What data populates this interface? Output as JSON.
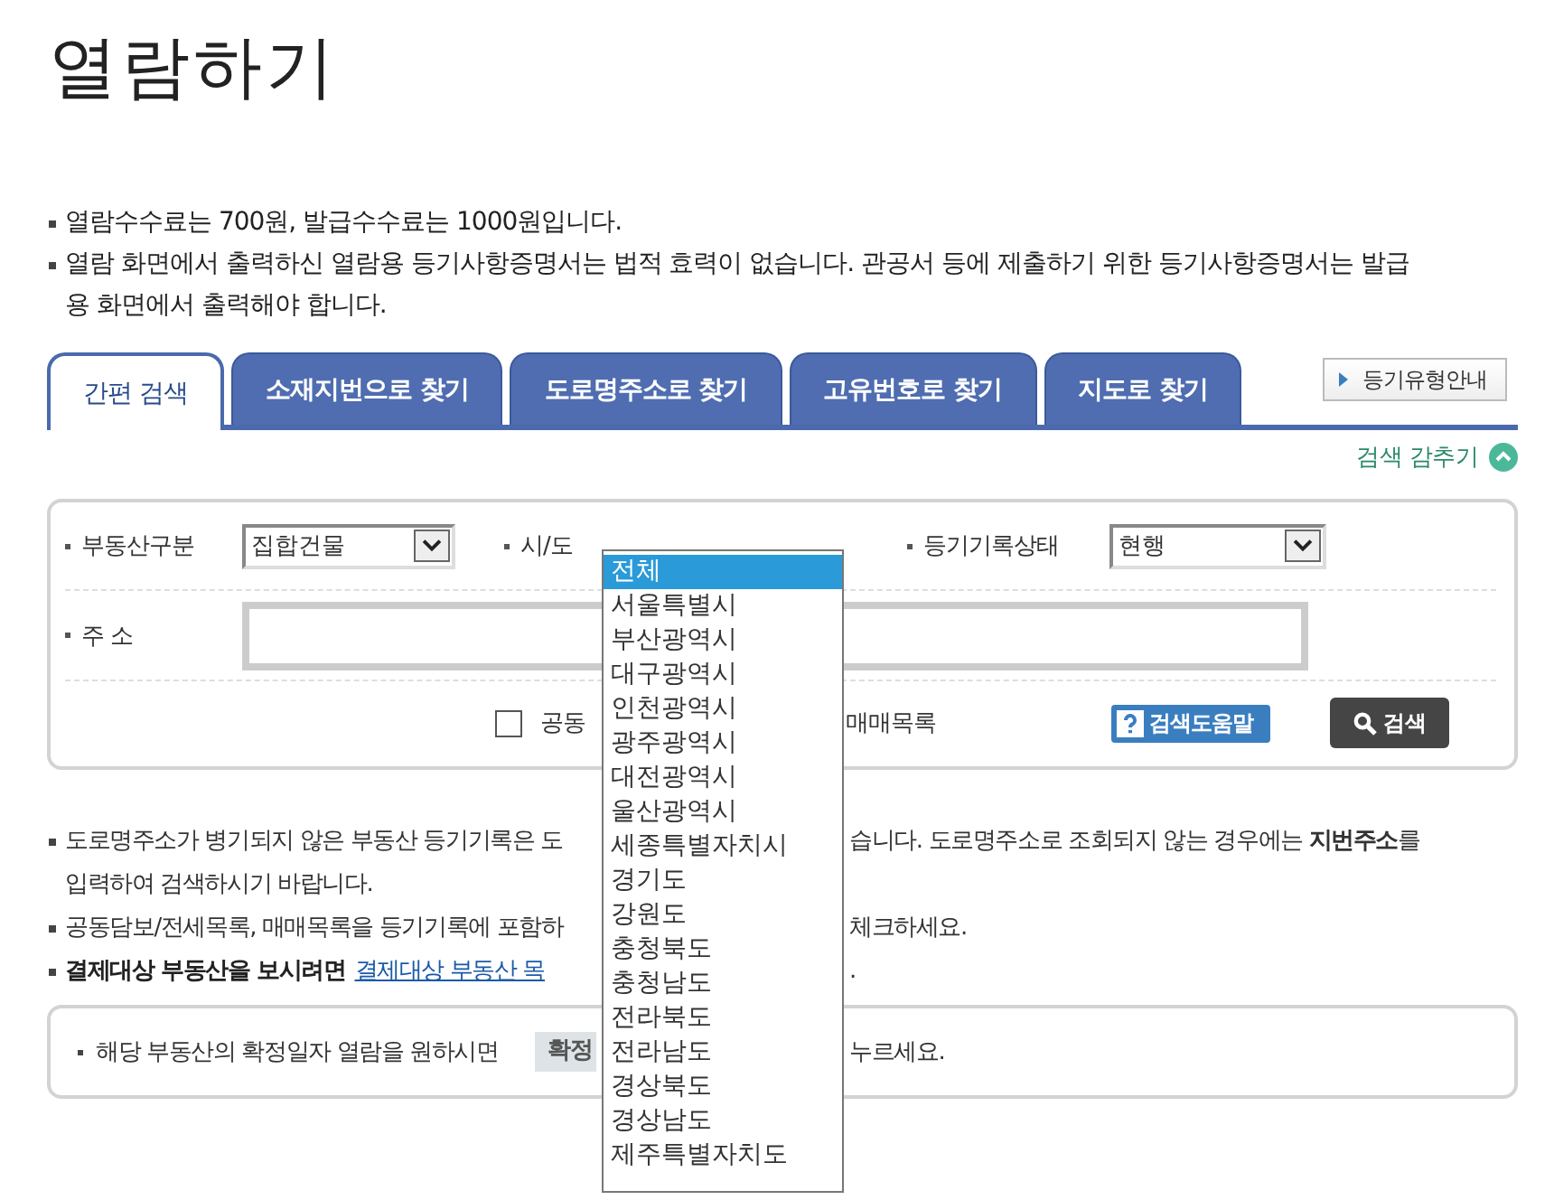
{
  "title": "열람하기",
  "notices": [
    "열람수수료는 700원, 발급수수료는 1000원입니다.",
    "열람 화면에서 출력하신 열람용 등기사항증명서는 법적 효력이 없습니다. 관공서 등에 제출하기 위한 등기사항증명서는 발급용 화면에서 출력해야 합니다."
  ],
  "tabs": [
    {
      "label": "간편 검색",
      "selected": true
    },
    {
      "label": "소재지번으로 찾기",
      "selected": false
    },
    {
      "label": "도로명주소로 찾기",
      "selected": false
    },
    {
      "label": "고유번호로 찾기",
      "selected": false
    },
    {
      "label": "지도로 찾기",
      "selected": false
    }
  ],
  "guide_button": "등기유형안내",
  "toggle_link": "검색 감추기",
  "form": {
    "property_type": {
      "label": "부동산구분",
      "value": "집합건물"
    },
    "region": {
      "label": "시/도",
      "options": [
        {
          "label": "전체",
          "selected": true
        },
        {
          "label": "서울특별시",
          "selected": false
        },
        {
          "label": "부산광역시",
          "selected": false
        },
        {
          "label": "대구광역시",
          "selected": false
        },
        {
          "label": "인천광역시",
          "selected": false
        },
        {
          "label": "광주광역시",
          "selected": false
        },
        {
          "label": "대전광역시",
          "selected": false
        },
        {
          "label": "울산광역시",
          "selected": false
        },
        {
          "label": "세종특별자치시",
          "selected": false
        },
        {
          "label": "경기도",
          "selected": false
        },
        {
          "label": "강원도",
          "selected": false
        },
        {
          "label": "충청북도",
          "selected": false
        },
        {
          "label": "충청남도",
          "selected": false
        },
        {
          "label": "전라북도",
          "selected": false
        },
        {
          "label": "전라남도",
          "selected": false
        },
        {
          "label": "경상북도",
          "selected": false
        },
        {
          "label": "경상남도",
          "selected": false
        },
        {
          "label": "제주특별자치도",
          "selected": false
        }
      ]
    },
    "record_status": {
      "label": "등기기록상태",
      "value": "현행"
    },
    "address": {
      "label": "주 소"
    },
    "include": {
      "label_left": "공동",
      "label_right": "매매목록",
      "checked": false
    },
    "help_button": "검색도움말",
    "search_button": "검색"
  },
  "notes": [
    {
      "strong": false,
      "left": "도로명주소가 병기되지 않은 부동산 등기기록은 도",
      "right": "습니다. 도로명주소로 조회되지 않는 경우에는 **지번주소**를",
      "continuation": "입력하여 검색하시기 바랍니다."
    },
    {
      "strong": false,
      "left": "공동담보/전세목록, 매매목록을 등기기록에 포함하",
      "right": "체크하세요."
    },
    {
      "strong": true,
      "left": "결제대상 부동산을 보시려면",
      "link": "결제대상 부동산 목",
      "right": "."
    }
  ],
  "box": {
    "text": "해당 부동산의 확정일자 열람을 원하시면",
    "button": "확정",
    "right": "누르세요."
  }
}
